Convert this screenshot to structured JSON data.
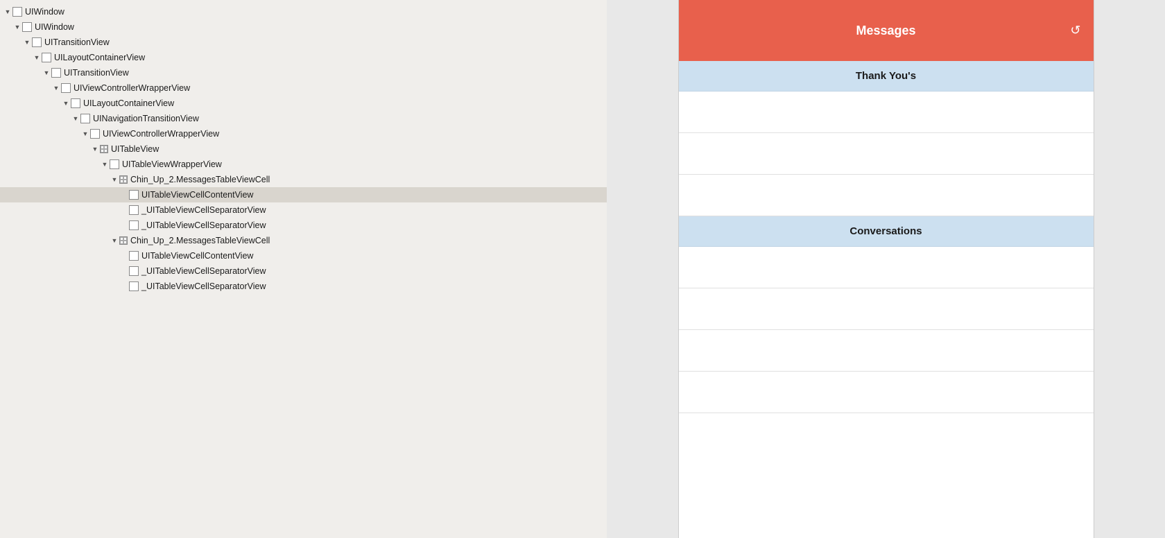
{
  "tree": {
    "items": [
      {
        "id": 1,
        "depth": 0,
        "arrow": "expanded",
        "icon": "box",
        "label": "UIWindow",
        "selected": false
      },
      {
        "id": 2,
        "depth": 1,
        "arrow": "expanded",
        "icon": "box",
        "label": "UIWindow",
        "selected": false
      },
      {
        "id": 3,
        "depth": 2,
        "arrow": "expanded",
        "icon": "box",
        "label": "UITransitionView",
        "selected": false
      },
      {
        "id": 4,
        "depth": 3,
        "arrow": "expanded",
        "icon": "box",
        "label": "UILayoutContainerView",
        "selected": false
      },
      {
        "id": 5,
        "depth": 4,
        "arrow": "expanded",
        "icon": "box",
        "label": "UITransitionView",
        "selected": false
      },
      {
        "id": 6,
        "depth": 5,
        "arrow": "expanded",
        "icon": "box",
        "label": "UIViewControllerWrapperView",
        "selected": false
      },
      {
        "id": 7,
        "depth": 6,
        "arrow": "expanded",
        "icon": "box",
        "label": "UILayoutContainerView",
        "selected": false
      },
      {
        "id": 8,
        "depth": 7,
        "arrow": "expanded",
        "icon": "box",
        "label": "UINavigationTransitionView",
        "selected": false
      },
      {
        "id": 9,
        "depth": 8,
        "arrow": "expanded",
        "icon": "box",
        "label": "UIViewControllerWrapperView",
        "selected": false
      },
      {
        "id": 10,
        "depth": 9,
        "arrow": "expanded",
        "icon": "table",
        "label": "UITableView",
        "selected": false
      },
      {
        "id": 11,
        "depth": 10,
        "arrow": "expanded",
        "icon": "box",
        "label": "UITableViewWrapperView",
        "selected": false
      },
      {
        "id": 12,
        "depth": 11,
        "arrow": "expanded",
        "icon": "table",
        "label": "Chin_Up_2.MessagesTableViewCell",
        "selected": false
      },
      {
        "id": 13,
        "depth": 12,
        "arrow": "leaf",
        "icon": "box",
        "label": "UITableViewCellContentView",
        "selected": true
      },
      {
        "id": 14,
        "depth": 12,
        "arrow": "leaf",
        "icon": "box",
        "label": "_UITableViewCellSeparatorView",
        "selected": false
      },
      {
        "id": 15,
        "depth": 12,
        "arrow": "leaf",
        "icon": "box",
        "label": "_UITableViewCellSeparatorView",
        "selected": false
      },
      {
        "id": 16,
        "depth": 11,
        "arrow": "expanded",
        "icon": "table",
        "label": "Chin_Up_2.MessagesTableViewCell",
        "selected": false
      },
      {
        "id": 17,
        "depth": 12,
        "arrow": "leaf",
        "icon": "box",
        "label": "UITableViewCellContentView",
        "selected": false
      },
      {
        "id": 18,
        "depth": 12,
        "arrow": "leaf",
        "icon": "box",
        "label": "_UITableViewCellSeparatorView",
        "selected": false
      },
      {
        "id": 19,
        "depth": 12,
        "arrow": "leaf",
        "icon": "box",
        "label": "_UITableViewCellSeparatorView",
        "selected": false
      }
    ]
  },
  "ios": {
    "navbar_title": "Messages",
    "refresh_icon": "↺",
    "sections": [
      {
        "header": "Thank You's",
        "cells": [
          {
            "empty": true
          },
          {
            "empty": true
          },
          {
            "empty": true
          }
        ]
      },
      {
        "header": "Conversations",
        "cells": [
          {
            "empty": true
          },
          {
            "empty": true
          },
          {
            "empty": true
          },
          {
            "empty": true
          }
        ]
      }
    ]
  }
}
